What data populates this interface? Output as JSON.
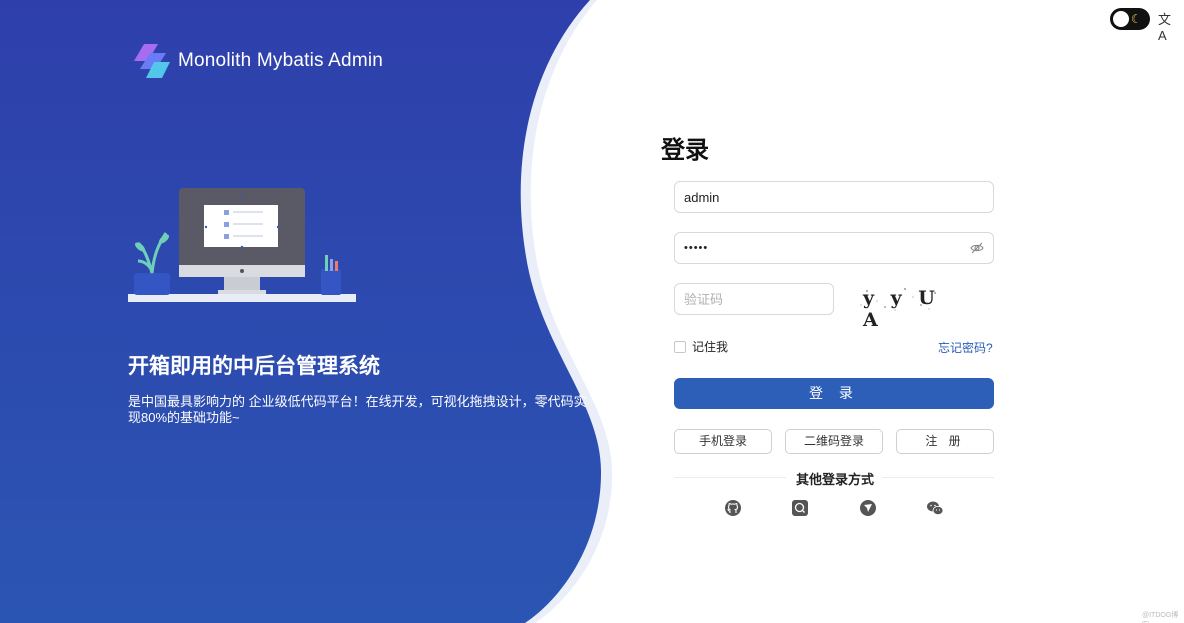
{
  "brand": {
    "title": "Monolith Mybatis Admin"
  },
  "slogan": {
    "title": "开箱即用的中后台管理系统",
    "description": "是中国最具影响力的 企业级低代码平台！在线开发，可视化拖拽设计，零代码实现80%的基础功能~"
  },
  "header": {
    "lang_label": "文A",
    "theme_icon": "moon-icon"
  },
  "login": {
    "title": "登录",
    "username": {
      "value": "admin",
      "placeholder": ""
    },
    "password": {
      "value": "•••••"
    },
    "captcha_field": {
      "placeholder": "验证码"
    },
    "captcha_image_text": "y y U A",
    "remember_label": "记住我",
    "forgot_label": "忘记密码?",
    "submit_label": "登 录",
    "phone_login_label": "手机登录",
    "qr_login_label": "二维码登录",
    "register_label": "注 册",
    "other_methods_label": "其他登录方式",
    "social_icons": [
      "github-icon",
      "qq-icon",
      "weibo-icon",
      "wechat-icon"
    ]
  },
  "colors": {
    "panel_blue": "#2f44ad",
    "primary": "#2d5eb8",
    "link": "#2a5bb7"
  },
  "watermark": "@ITDOG博客"
}
